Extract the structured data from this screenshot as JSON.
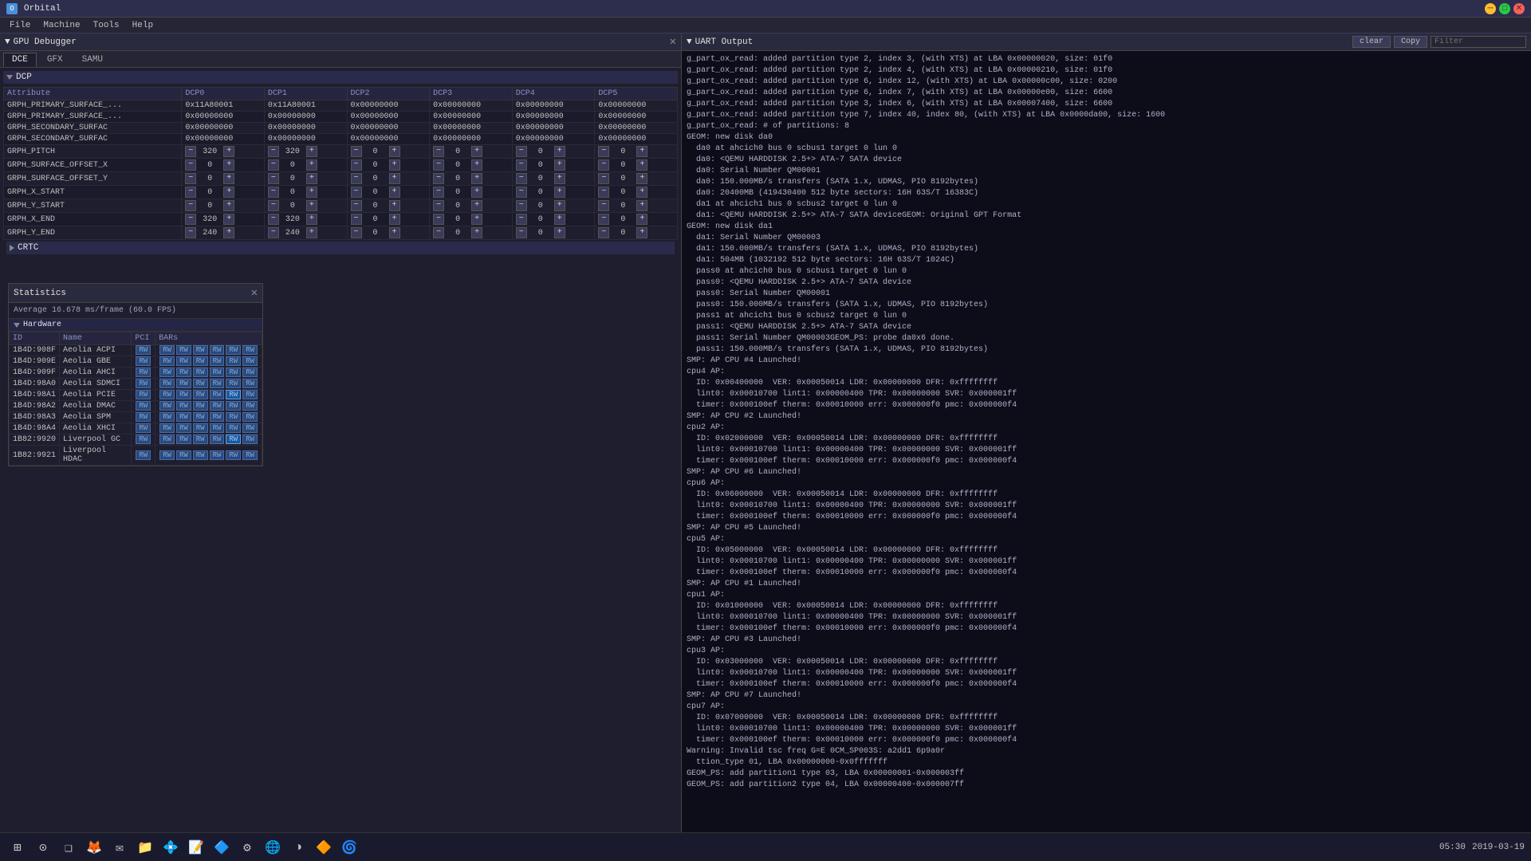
{
  "app": {
    "title": "Orbital",
    "menu_items": [
      "File",
      "Machine",
      "Tools",
      "Help"
    ]
  },
  "gpu_debugger": {
    "title": "GPU Debugger",
    "tabs": [
      "DCE",
      "GFX",
      "SAMU"
    ],
    "active_tab": "DCE",
    "dcp_section": {
      "label": "DCP",
      "columns": [
        "Attribute",
        "DCP0",
        "DCP1",
        "DCP2",
        "DCP3",
        "DCP4",
        "DCP5"
      ],
      "rows": [
        {
          "attr": "GRPH_PRIMARY_SURFACE_...",
          "dcp0": "0x11A80001",
          "dcp1": "0x11A80001",
          "dcp2": "0x00000000",
          "dcp3": "0x00000000",
          "dcp4": "0x00000000",
          "dcp5": "0x00000000"
        },
        {
          "attr": "GRPH_PRIMARY_SURFACE_...",
          "dcp0": "0x00000000",
          "dcp1": "0x00000000",
          "dcp2": "0x00000000",
          "dcp3": "0x00000000",
          "dcp4": "0x00000000",
          "dcp5": "0x00000000"
        },
        {
          "attr": "GRPH_SECONDARY_SURFAC",
          "dcp0": "0x00000000",
          "dcp1": "0x00000000",
          "dcp2": "0x00000000",
          "dcp3": "0x00000000",
          "dcp4": "0x00000000",
          "dcp5": "0x00000000"
        },
        {
          "attr": "GRPH_SECONDARY_SURFAC",
          "dcp0": "0x00000000",
          "dcp1": "0x00000000",
          "dcp2": "0x00000000",
          "dcp3": "0x00000000",
          "dcp4": "0x00000000",
          "dcp5": "0x00000000"
        },
        {
          "attr": "GRPH_PITCH",
          "dcp0": "320",
          "dcp1": "320",
          "dcp2": "0",
          "dcp3": "0",
          "dcp4": "0",
          "dcp5": "0",
          "has_ctrl": true
        },
        {
          "attr": "GRPH_SURFACE_OFFSET_X",
          "dcp0": "0",
          "dcp1": "0",
          "dcp2": "0",
          "dcp3": "0",
          "dcp4": "0",
          "dcp5": "0",
          "has_ctrl": true
        },
        {
          "attr": "GRPH_SURFACE_OFFSET_Y",
          "dcp0": "0",
          "dcp1": "0",
          "dcp2": "0",
          "dcp3": "0",
          "dcp4": "0",
          "dcp5": "0",
          "has_ctrl": true
        },
        {
          "attr": "GRPH_X_START",
          "dcp0": "0",
          "dcp1": "0",
          "dcp2": "0",
          "dcp3": "0",
          "dcp4": "0",
          "dcp5": "0",
          "has_ctrl": true
        },
        {
          "attr": "GRPH_Y_START",
          "dcp0": "0",
          "dcp1": "0",
          "dcp2": "0",
          "dcp3": "0",
          "dcp4": "0",
          "dcp5": "0",
          "has_ctrl": true
        },
        {
          "attr": "GRPH_X_END",
          "dcp0": "320",
          "dcp1": "320",
          "dcp2": "0",
          "dcp3": "0",
          "dcp4": "0",
          "dcp5": "0",
          "has_ctrl": true
        },
        {
          "attr": "GRPH_Y_END",
          "dcp0": "240",
          "dcp1": "240",
          "dcp2": "0",
          "dcp3": "0",
          "dcp4": "0",
          "dcp5": "0",
          "has_ctrl": true
        }
      ]
    },
    "crtc_section": {
      "label": "CRTC"
    }
  },
  "statistics": {
    "title": "Statistics",
    "fps_text": "Average 16.678 ms/frame (60.0 FPS)",
    "section": "Hardware",
    "columns": [
      "ID",
      "Name",
      "PCI",
      "BARs"
    ],
    "devices": [
      {
        "id": "1B4D:908F",
        "name": "Aeolia ACPI",
        "pci": "RW",
        "bars": [
          "RW",
          "RW",
          "RW",
          "RW",
          "RW",
          "RW"
        ]
      },
      {
        "id": "1B4D:909E",
        "name": "Aeolia GBE",
        "pci": "RW",
        "bars": [
          "RW",
          "RW",
          "RW",
          "RW",
          "RW",
          "RW"
        ]
      },
      {
        "id": "1B4D:909F",
        "name": "Aeolia AHCI",
        "pci": "RW",
        "bars": [
          "RW",
          "RW",
          "RW",
          "RW",
          "RW",
          "RW"
        ]
      },
      {
        "id": "1B4D:98A0",
        "name": "Aeolia SDMCI",
        "pci": "RW",
        "bars": [
          "RW",
          "RW",
          "RW",
          "RW",
          "RW",
          "RW"
        ]
      },
      {
        "id": "1B4D:98A1",
        "name": "Aeolia PCIE",
        "pci": "RW",
        "bars": [
          "RW",
          "RW",
          "RW",
          "RW",
          "RW",
          "RW"
        ],
        "highlight_bar": 4
      },
      {
        "id": "1B4D:98A2",
        "name": "Aeolia DMAC",
        "pci": "RW",
        "bars": [
          "RW",
          "RW",
          "RW",
          "RW",
          "RW",
          "RW"
        ]
      },
      {
        "id": "1B4D:98A3",
        "name": "Aeolia SPM",
        "pci": "RW",
        "bars": [
          "RW",
          "RW",
          "RW",
          "RW",
          "RW",
          "RW"
        ]
      },
      {
        "id": "1B4D:98A4",
        "name": "Aeolia XHCI",
        "pci": "RW",
        "bars": [
          "RW",
          "RW",
          "RW",
          "RW",
          "RW",
          "RW"
        ]
      },
      {
        "id": "1B82:9920",
        "name": "Liverpool GC",
        "pci": "RW",
        "bars": [
          "RW",
          "RW",
          "RW",
          "RW",
          "RW",
          "RW"
        ],
        "highlight_bar": 4
      },
      {
        "id": "1B82:9921",
        "name": "Liverpool HDAC",
        "pci": "RW",
        "bars": [
          "RW",
          "RW",
          "RW",
          "RW",
          "RW",
          "RW"
        ]
      }
    ]
  },
  "uart": {
    "title": "UART Output",
    "clear_label": "clear",
    "copy_label": "Copy",
    "filter_placeholder": "Filter",
    "log_lines": [
      "g_part_ox_read: added partition type 2, index 3, (with XTS) at LBA 0x00000020, size: 01f0",
      "g_part_ox_read: added partition type 2, index 4, (with XTS) at LBA 0x00000210, size: 01f0",
      "g_part_ox_read: added partition type 6, index 12, (with XTS) at LBA 0x00000c00, size: 0200",
      "g_part_ox_read: added partition type 6, index 7, (with XTS) at LBA 0x00000e00, size: 6600",
      "g_part_ox_read: added partition type 3, index 6, (with XTS) at LBA 0x00007400, size: 6600",
      "g_part_ox_read: added partition type 7, index 40, index 80, (with XTS) at LBA 0x0000da00, size: 1600",
      "g_part_ox_read: # of partitions: 8",
      "GEOM: new disk da0",
      "  da0 at ahcich0 bus 0 scbus1 target 0 lun 0",
      "  da0: <QEMU HARDDISK 2.5+> ATA-7 SATA device",
      "  da0: Serial Number QM00001",
      "  da0: 150.000MB/s transfers (SATA 1.x, UDMAS, PIO 8192bytes)",
      "  da0: 20400MB (419430400 512 byte sectors: 16H 63S/T 16383C)",
      "  da1 at ahcich1 bus 0 scbus2 target 0 lun 0",
      "  da1: <QEMU HARDDISK 2.5+> ATA-7 SATA deviceGEOM: Original GPT Format",
      "",
      "GEOM: new disk da1",
      "  da1: Serial Number QM00003",
      "  da1: 150.000MB/s transfers (SATA 1.x, UDMAS, PIO 8192bytes)",
      "  da1: 504MB (1032192 512 byte sectors: 16H 63S/T 1024C)",
      "  pass0 at ahcich0 bus 0 scbus1 target 0 lun 0",
      "  pass0: <QEMU HARDDISK 2.5+> ATA-7 SATA device",
      "  pass0: Serial Number QM00001",
      "  pass0: 150.000MB/s transfers (SATA 1.x, UDMAS, PIO 8192bytes)",
      "  pass1 at ahcich1 bus 0 scbus2 target 0 lun 0",
      "  pass1: <QEMU HARDDISK 2.5+> ATA-7 SATA device",
      "  pass1: Serial Number QM00003GEOM_PS: probe da0x6 done.",
      "",
      "  pass1: 150.000MB/s transfers (SATA 1.x, UDMAS, PIO 8192bytes)",
      "SMP: AP CPU #4 Launched!",
      "cpu4 AP:",
      "  ID: 0x00400000  VER: 0x00050014 LDR: 0x00000000 DFR: 0xffffffff",
      "  lint0: 0x00010700 lint1: 0x00000400 TPR: 0x00000000 SVR: 0x000001ff",
      "  timer: 0x000100ef therm: 0x00010000 err: 0x000000f0 pmc: 0x000000f4",
      "SMP: AP CPU #2 Launched!",
      "cpu2 AP:",
      "  ID: 0x02000000  VER: 0x00050014 LDR: 0x00000000 DFR: 0xffffffff",
      "  lint0: 0x00010700 lint1: 0x00000400 TPR: 0x00000000 SVR: 0x000001ff",
      "  timer: 0x000100ef therm: 0x00010000 err: 0x000000f0 pmc: 0x000000f4",
      "SMP: AP CPU #6 Launched!",
      "cpu6 AP:",
      "  ID: 0x06000000  VER: 0x00050014 LDR: 0x00000000 DFR: 0xffffffff",
      "  lint0: 0x00010700 lint1: 0x00000400 TPR: 0x00000000 SVR: 0x000001ff",
      "  timer: 0x000100ef therm: 0x00010000 err: 0x000000f0 pmc: 0x000000f4",
      "SMP: AP CPU #5 Launched!",
      "cpu5 AP:",
      "  ID: 0x05000000  VER: 0x00050014 LDR: 0x00000000 DFR: 0xffffffff",
      "  lint0: 0x00010700 lint1: 0x00000400 TPR: 0x00000000 SVR: 0x000001ff",
      "  timer: 0x000100ef therm: 0x00010000 err: 0x000000f0 pmc: 0x000000f4",
      "SMP: AP CPU #1 Launched!",
      "cpu1 AP:",
      "  ID: 0x01000000  VER: 0x00050014 LDR: 0x00000000 DFR: 0xffffffff",
      "  lint0: 0x00010700 lint1: 0x00000400 TPR: 0x00000000 SVR: 0x000001ff",
      "  timer: 0x000100ef therm: 0x00010000 err: 0x000000f0 pmc: 0x000000f4",
      "SMP: AP CPU #3 Launched!",
      "cpu3 AP:",
      "  ID: 0x03000000  VER: 0x00050014 LDR: 0x00000000 DFR: 0xffffffff",
      "  lint0: 0x00010700 lint1: 0x00000400 TPR: 0x00000000 SVR: 0x000001ff",
      "  timer: 0x000100ef therm: 0x00010000 err: 0x000000f0 pmc: 0x000000f4",
      "SMP: AP CPU #7 Launched!",
      "cpu7 AP:",
      "  ID: 0x07000000  VER: 0x00050014 LDR: 0x00000000 DFR: 0xffffffff",
      "  lint0: 0x00010700 lint1: 0x00000400 TPR: 0x00000000 SVR: 0x000001ff",
      "  timer: 0x000100ef therm: 0x00010000 err: 0x000000f0 pmc: 0x000000f4",
      "Warning: Invalid tsc freq G=E 0CM_SP003S: a2dd1 6p9a0r",
      "  ttion_type 01, LBA 0x00000000-0x0fffffff",
      "GEOM_PS: add partition1 type 03, LBA 0x00000001-0x000003ff",
      "GEOM_PS: add partition2 type 04, LBA 0x00000400-0x000007ff"
    ]
  },
  "taskbar": {
    "time": "05:30",
    "date": "2019-03-19",
    "icons": [
      {
        "name": "start",
        "symbol": "⊞"
      },
      {
        "name": "search",
        "symbol": "⊙"
      },
      {
        "name": "taskview",
        "symbol": "❑"
      },
      {
        "name": "firefox",
        "symbol": "🦊"
      },
      {
        "name": "mail",
        "symbol": "✉"
      },
      {
        "name": "files",
        "symbol": "📁"
      },
      {
        "name": "vs",
        "symbol": "💠"
      },
      {
        "name": "notepad",
        "symbol": "📝"
      },
      {
        "name": "app1",
        "symbol": "🔷"
      },
      {
        "name": "orbital",
        "symbol": "⚙"
      },
      {
        "name": "browser",
        "symbol": "🌐"
      },
      {
        "name": "chrome",
        "symbol": "◑"
      },
      {
        "name": "app2",
        "symbol": "🔶"
      },
      {
        "name": "app3",
        "symbol": "🌀"
      }
    ]
  }
}
